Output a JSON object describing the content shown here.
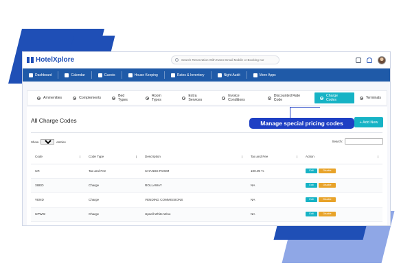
{
  "app": {
    "name": "HotelXplore"
  },
  "search": {
    "placeholder": "Search Reservation With Name Email Mobile or Booking nur"
  },
  "nav": [
    {
      "label": "Dashboard"
    },
    {
      "label": "Calendar"
    },
    {
      "label": "Guests"
    },
    {
      "label": "House Keeping"
    },
    {
      "label": "Rates & Inventory"
    },
    {
      "label": "Night Audit"
    },
    {
      "label": "More Apps"
    }
  ],
  "tabs": [
    {
      "label": "Ammenities"
    },
    {
      "label": "Complements"
    },
    {
      "label": "Bed Types"
    },
    {
      "label": "Room Types"
    },
    {
      "label": "Extra Services"
    },
    {
      "label": "Invoice Conditions"
    },
    {
      "label": "Discounted Rate Code"
    },
    {
      "label": "Charge Codes"
    },
    {
      "label": "Terminals"
    }
  ],
  "page": {
    "title": "All Charge Codes",
    "add_label": "+ Add New",
    "callout": "Manage special pricing codes",
    "show_label": "Show",
    "show_value": "10",
    "entries_label": "entries",
    "search_label": "Search:"
  },
  "table": {
    "columns": [
      "Code",
      "Code Type",
      "Description",
      "Tax and Fee",
      "Action"
    ],
    "rows": [
      {
        "code": "CR",
        "type": "Tax and Fee",
        "description": "CHANGE ROOM",
        "tax": "100.00 %"
      },
      {
        "code": "XBED",
        "type": "Charge",
        "description": "ROLLAWAY",
        "tax": "NA"
      },
      {
        "code": "VEND",
        "type": "Charge",
        "description": "VENDING COMMISSIONS",
        "tax": "NA"
      },
      {
        "code": "UPWW",
        "type": "Charge",
        "description": "Upsell White Wine",
        "tax": "NA"
      }
    ],
    "edit_label": "Edit",
    "disable_label": "Disable"
  },
  "colors": {
    "brand": "#1f5aa8",
    "accent": "#16b3c5",
    "warning": "#e8a32a",
    "callout": "#1e3fc4"
  }
}
